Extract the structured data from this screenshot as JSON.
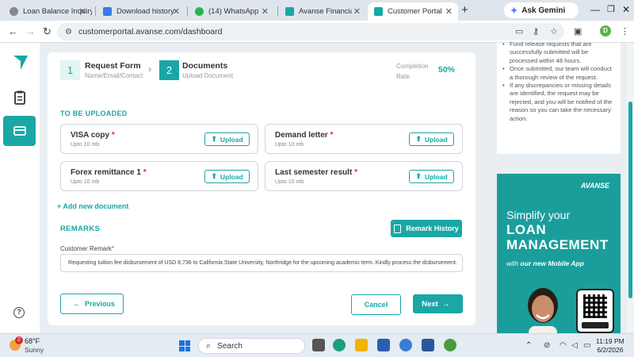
{
  "browser": {
    "tabs": [
      {
        "label": "Loan Balance Inquiry"
      },
      {
        "label": "Download history"
      },
      {
        "label": "(14) WhatsApp"
      },
      {
        "label": "Avanse Financial Serv"
      },
      {
        "label": "Customer Portal"
      }
    ],
    "new_tab": "+",
    "gemini_label": "Ask Gemini",
    "url": "customerportal.avanse.com/dashboard",
    "profile_initial": "D"
  },
  "stepper": {
    "step1": {
      "num": "1",
      "title": "Request Form",
      "sub": "Name/Email/Contact"
    },
    "step2": {
      "num": "2",
      "title": "Documents",
      "sub": "Upload Document"
    },
    "completion_label_1": "Completion",
    "completion_label_2": "Rate",
    "completion_value": "50%"
  },
  "uploads": {
    "section_label": "TO BE UPLOADED",
    "docs": [
      {
        "title": "VISA copy",
        "size": "Upto 10 mb",
        "button": "Upload"
      },
      {
        "title": "Demand letter",
        "size": "Upto 10 mb",
        "button": "Upload"
      },
      {
        "title": "Forex remittance 1",
        "size": "Upto 10 mb",
        "button": "Upload"
      },
      {
        "title": "Last semester result",
        "size": "Upto 10 mb",
        "button": "Upload"
      }
    ],
    "add_new": "+ Add new document"
  },
  "remarks": {
    "section_label": "REMARKS",
    "history_button": "Remark History",
    "field_label": "Customer Remark",
    "field_value": "Requesting tuition fee disbursement of USD 8,736 to California State University, Northridge for the upcoming academic term. Kindly process the disbursement."
  },
  "actions": {
    "previous": "Previous",
    "cancel": "Cancel",
    "next": "Next"
  },
  "info_panel": {
    "items": [
      "Fund release requests that are successfully submitted will be processed within 48 hours.",
      "Once submitted, our team will conduct a thorough review of the request.",
      "If any discrepancies or missing details are identified, the request may be rejected, and you will be notified of the reason so you can take the necessary action."
    ]
  },
  "promo": {
    "brand": "AVANSE",
    "line1": "Simplify your",
    "line2": "LOAN",
    "line3": "MANAGEMENT",
    "line4_pre": "with",
    "line4_bold": "our new Mobile App"
  },
  "taskbar": {
    "weather_badge": "2",
    "temperature": "68°F",
    "condition": "Sunny",
    "search_placeholder": "Search",
    "time": "11:19 PM",
    "date": "6/2/2026"
  },
  "colors": {
    "accent": "#1aa7a5",
    "required": "#e0263a"
  }
}
